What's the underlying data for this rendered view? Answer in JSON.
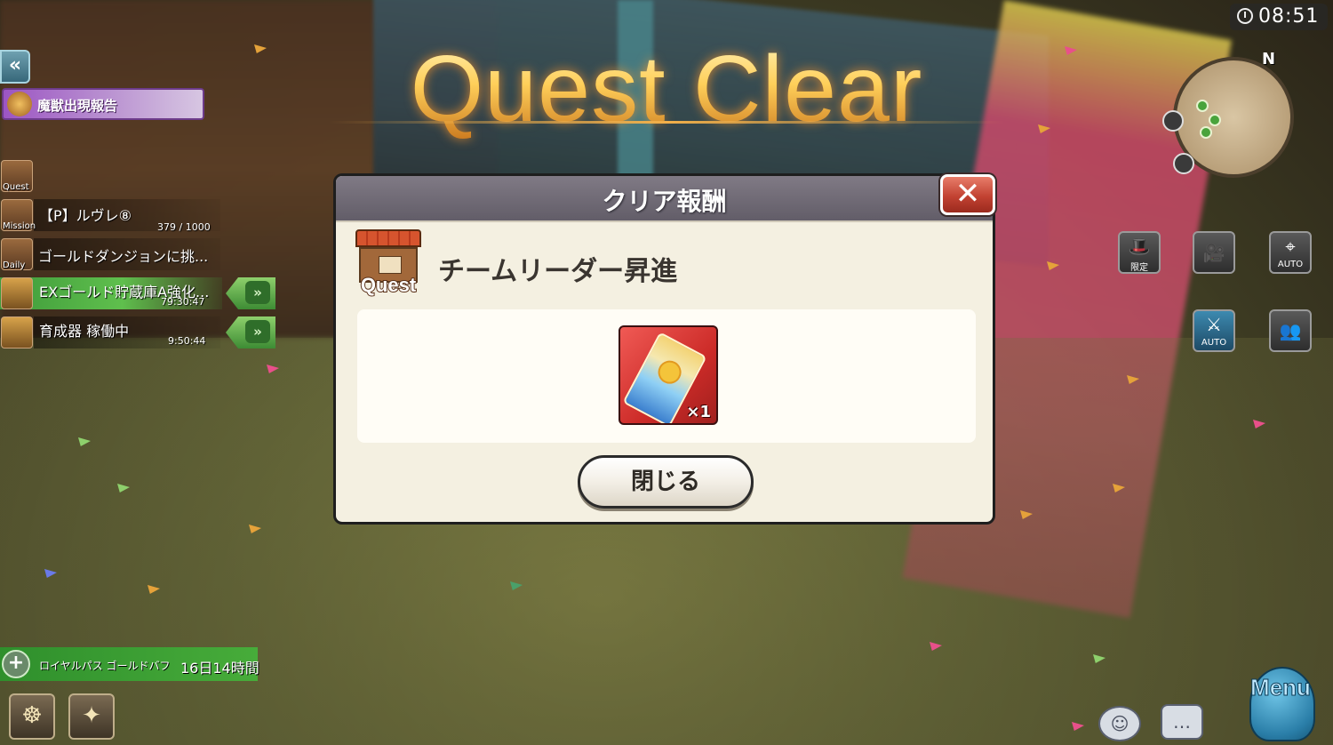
{
  "title": "Quest Clear",
  "clock": "08:51",
  "minimap": {
    "north_label": "N"
  },
  "left_hud": {
    "boss_notice": "魔獣出現報告",
    "quest_tab": "Quest",
    "mission": {
      "tab": "Mission",
      "name": "【P】ルヴレ⑧",
      "progress": "379 / 1000"
    },
    "daily": {
      "tab": "Daily",
      "name": "ゴールドダンジョンに挑..."
    },
    "timers": [
      {
        "name": "EXゴールド貯蔵庫A強化...",
        "time": "79:30:47"
      },
      {
        "name": "育成器 稼働中",
        "time": "9:50:44"
      }
    ]
  },
  "right_hud": {
    "limited_label": "限定",
    "auto_label": "AUTO",
    "auto2_label": "AUTO"
  },
  "dialog": {
    "title": "クリア報酬",
    "quest_icon_label": "Quest",
    "quest_name": "チームリーダー昇進",
    "reward_qty": "×1",
    "close_button": "閉じる"
  },
  "bottom_left": {
    "pass_label": "ロイヤルパス ゴールドバフ",
    "pass_time": "16日14時間"
  },
  "bottom_right": {
    "menu_label": "Menu"
  },
  "colors": {
    "title_gold": "#ffcf5a",
    "dialog_bg": "#f4f0e1",
    "dialog_header": "#6e6874",
    "close_red": "#c24232",
    "timer_green": "#47ac3a",
    "reward_red": "#cc2b28"
  }
}
